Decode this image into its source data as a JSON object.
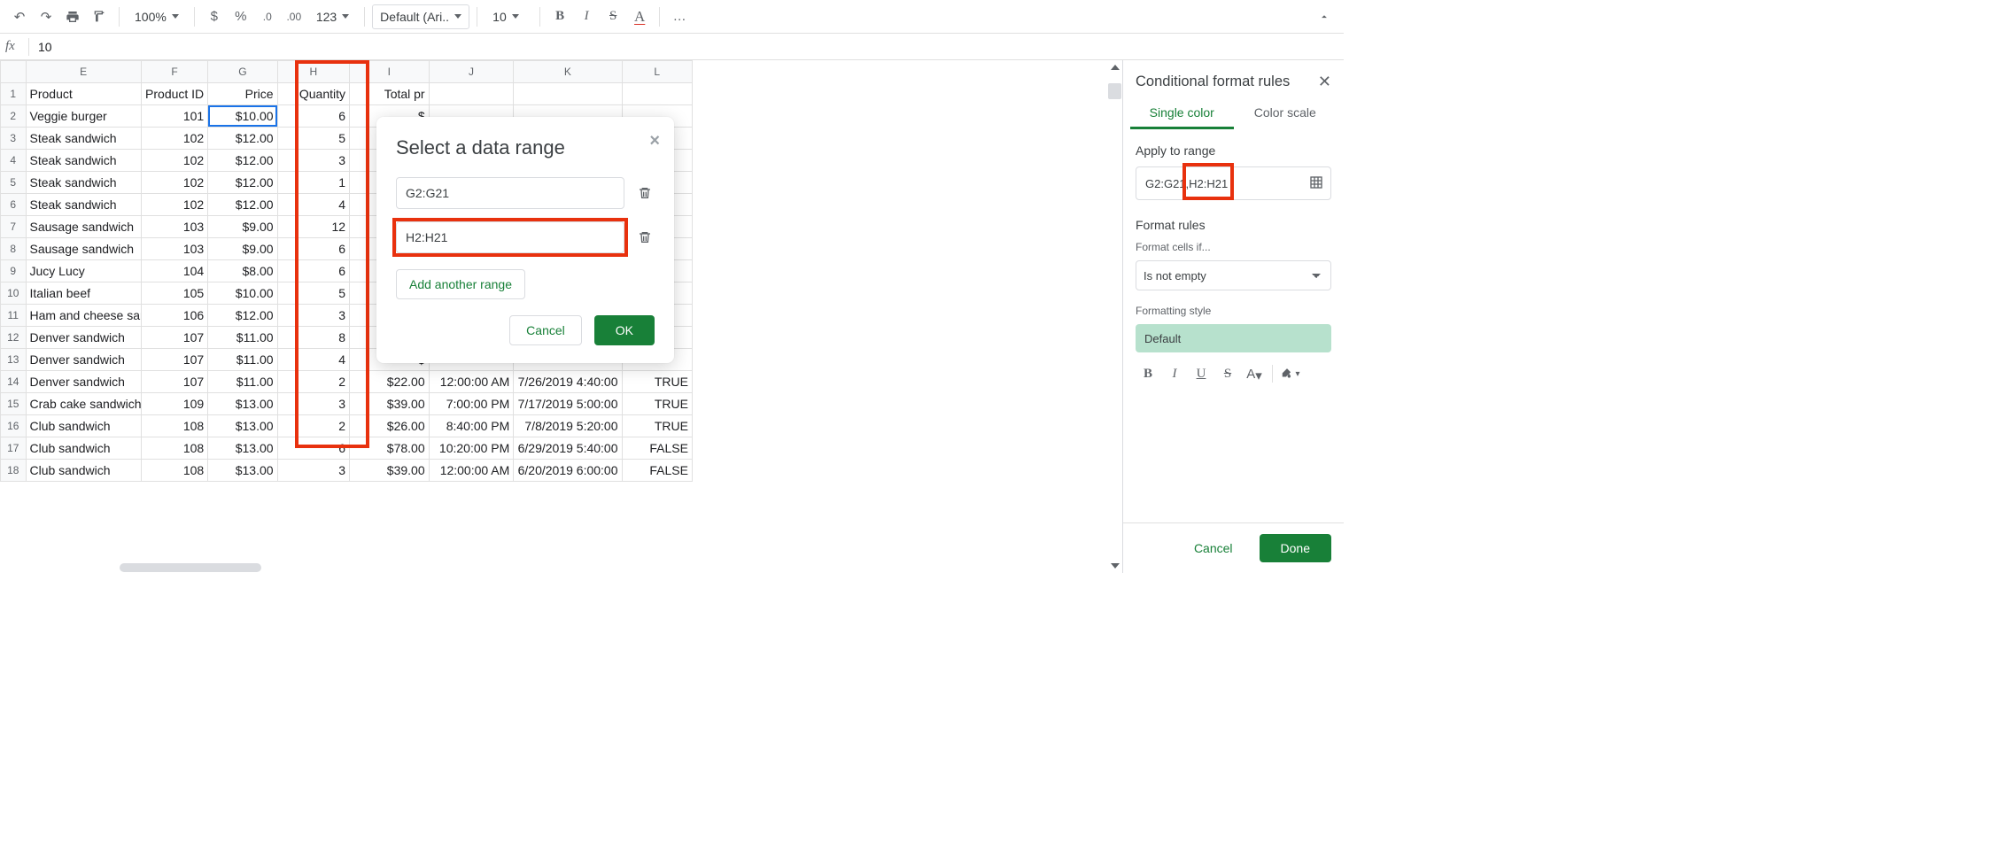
{
  "toolbar": {
    "zoom": "100%",
    "decimal_dec": ".0",
    "decimal_inc": ".00",
    "format_123": "123",
    "font": "Default (Ari...",
    "font_size": "10",
    "more": "…"
  },
  "formula_bar": {
    "fx": "fx",
    "value": "10"
  },
  "columns": [
    "E",
    "F",
    "G",
    "H",
    "I",
    "J",
    "K",
    "L"
  ],
  "headers": {
    "E": "Product",
    "F": "Product ID",
    "G": "Price",
    "H": "Quantity",
    "I": "Total pr",
    "J": "",
    "K": "",
    "L": ""
  },
  "rows": [
    {
      "n": 1,
      "E": "Product",
      "F": "Product ID",
      "G": "Price",
      "H": "Quantity",
      "I": "Total pr",
      "J": "",
      "K": "",
      "L": "",
      "isHeader": true
    },
    {
      "n": 2,
      "E": "Veggie burger",
      "F": "101",
      "G": "$10.00",
      "H": "6",
      "I": "$",
      "J": "",
      "K": "",
      "L": ""
    },
    {
      "n": 3,
      "E": "Steak sandwich",
      "F": "102",
      "G": "$12.00",
      "H": "5",
      "I": "",
      "J": "",
      "K": "",
      "L": ""
    },
    {
      "n": 4,
      "E": "Steak sandwich",
      "F": "102",
      "G": "$12.00",
      "H": "3",
      "I": "",
      "J": "",
      "K": "",
      "L": ""
    },
    {
      "n": 5,
      "E": "Steak sandwich",
      "F": "102",
      "G": "$12.00",
      "H": "1",
      "I": "",
      "J": "",
      "K": "",
      "L": ""
    },
    {
      "n": 6,
      "E": "Steak sandwich",
      "F": "102",
      "G": "$12.00",
      "H": "4",
      "I": "",
      "J": "",
      "K": "",
      "L": ""
    },
    {
      "n": 7,
      "E": "Sausage sandwich",
      "F": "103",
      "G": "$9.00",
      "H": "12",
      "I": "$",
      "J": "",
      "K": "",
      "L": ""
    },
    {
      "n": 8,
      "E": "Sausage sandwich",
      "F": "103",
      "G": "$9.00",
      "H": "6",
      "I": "$",
      "J": "",
      "K": "",
      "L": ""
    },
    {
      "n": 9,
      "E": "Jucy Lucy",
      "F": "104",
      "G": "$8.00",
      "H": "6",
      "I": "$",
      "J": "",
      "K": "",
      "L": ""
    },
    {
      "n": 10,
      "E": "Italian beef",
      "F": "105",
      "G": "$10.00",
      "H": "5",
      "I": "$",
      "J": "",
      "K": "",
      "L": ""
    },
    {
      "n": 11,
      "E": "Ham and cheese san",
      "F": "106",
      "G": "$12.00",
      "H": "3",
      "I": "$",
      "J": "",
      "K": "",
      "L": ""
    },
    {
      "n": 12,
      "E": "Denver sandwich",
      "F": "107",
      "G": "$11.00",
      "H": "8",
      "I": "$",
      "J": "",
      "K": "",
      "L": ""
    },
    {
      "n": 13,
      "E": "Denver sandwich",
      "F": "107",
      "G": "$11.00",
      "H": "4",
      "I": "$",
      "J": "",
      "K": "",
      "L": ""
    },
    {
      "n": 14,
      "E": "Denver sandwich",
      "F": "107",
      "G": "$11.00",
      "H": "2",
      "I": "$22.00",
      "J": "12:00:00 AM",
      "K": "7/26/2019 4:40:00",
      "L": "TRUE"
    },
    {
      "n": 15,
      "E": "Crab cake sandwich",
      "F": "109",
      "G": "$13.00",
      "H": "3",
      "I": "$39.00",
      "J": "7:00:00 PM",
      "K": "7/17/2019 5:00:00",
      "L": "TRUE"
    },
    {
      "n": 16,
      "E": "Club sandwich",
      "F": "108",
      "G": "$13.00",
      "H": "2",
      "I": "$26.00",
      "J": "8:40:00 PM",
      "K": "7/8/2019 5:20:00",
      "L": "TRUE"
    },
    {
      "n": 17,
      "E": "Club sandwich",
      "F": "108",
      "G": "$13.00",
      "H": "6",
      "I": "$78.00",
      "J": "10:20:00 PM",
      "K": "6/29/2019 5:40:00",
      "L": "FALSE"
    },
    {
      "n": 18,
      "E": "Club sandwich",
      "F": "108",
      "G": "$13.00",
      "H": "3",
      "I": "$39.00",
      "J": "12:00:00 AM",
      "K": "6/20/2019 6:00:00",
      "L": "FALSE"
    }
  ],
  "dialog": {
    "title": "Select a data range",
    "range1": "G2:G21",
    "range2": "H2:H21",
    "add_range": "Add another range",
    "cancel": "Cancel",
    "ok": "OK"
  },
  "side": {
    "title": "Conditional format rules",
    "tab_single": "Single color",
    "tab_scale": "Color scale",
    "apply_label": "Apply to range",
    "range_value": "G2:G21,H2:H21",
    "range_seg1": "G2:G21",
    "range_seg2": "H2:H21",
    "rules_label": "Format rules",
    "cells_if_label": "Format cells if...",
    "rule_value": "Is not empty",
    "style_label": "Formatting style",
    "style_chip": "Default",
    "cancel": "Cancel",
    "done": "Done"
  }
}
